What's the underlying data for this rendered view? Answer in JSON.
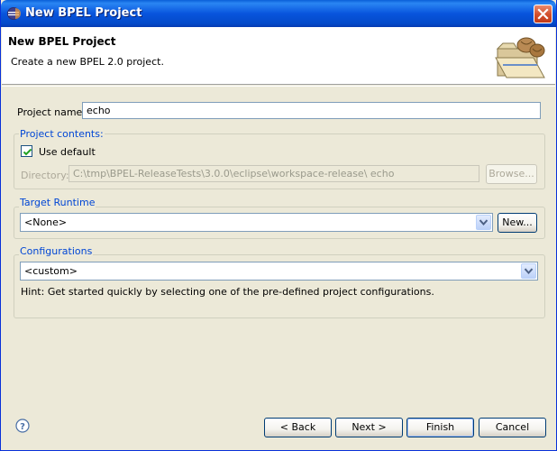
{
  "window": {
    "title": "New BPEL Project"
  },
  "banner": {
    "title": "New BPEL Project",
    "description": "Create a new BPEL 2.0 project."
  },
  "project_name": {
    "label": "Project name:",
    "value": "echo"
  },
  "project_contents": {
    "group_title": "Project contents:",
    "use_default_label": "Use default",
    "use_default_checked": true,
    "directory_label": "Directory:",
    "directory_value": "C:\\tmp\\BPEL-ReleaseTests\\3.0.0\\eclipse\\workspace-release\\ echo",
    "browse_label": "Browse..."
  },
  "target_runtime": {
    "group_title": "Target Runtime",
    "selected": "<None>",
    "new_label": "New..."
  },
  "configurations": {
    "group_title": "Configurations",
    "selected": "<custom>",
    "hint": "Hint: Get started quickly by selecting one of the pre-defined project configurations."
  },
  "buttons": {
    "back": "< Back",
    "next": "Next >",
    "finish": "Finish",
    "cancel": "Cancel"
  },
  "icons": {
    "title": "eclipse-icon",
    "close": "close-icon",
    "banner": "folder-beans-icon",
    "help": "help-icon"
  },
  "colors": {
    "titlebar": "#0855dd",
    "group_title": "#0046d5",
    "dialog_bg": "#ece9d8"
  }
}
